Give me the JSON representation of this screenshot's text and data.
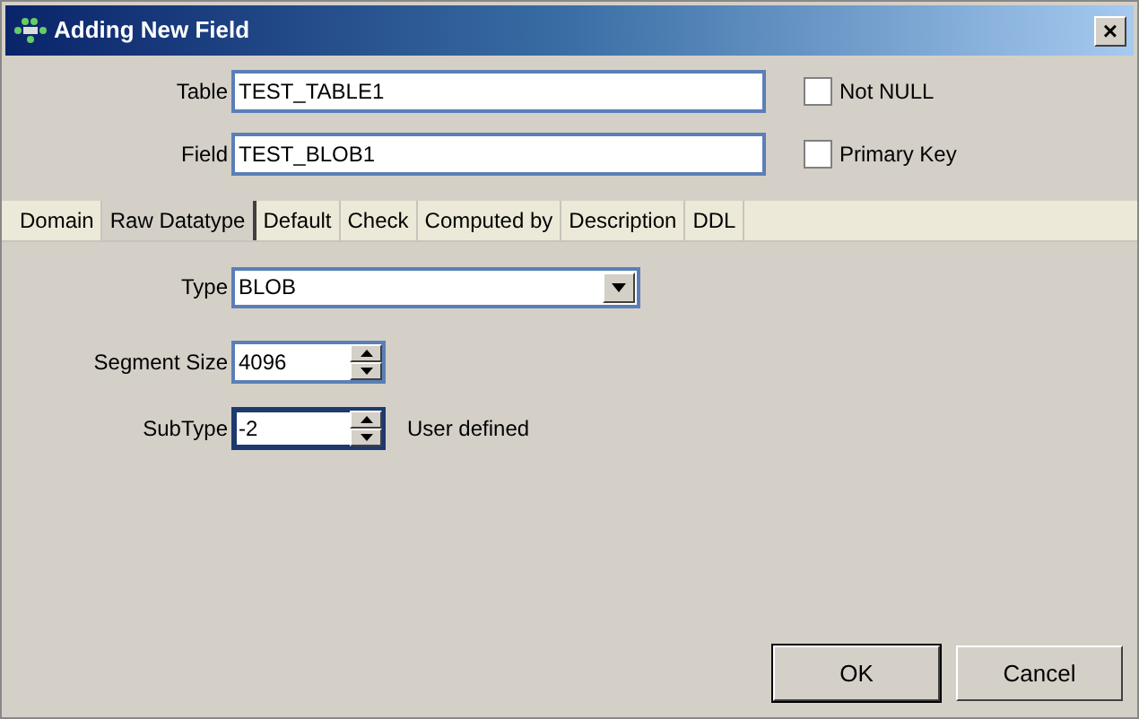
{
  "window": {
    "title": "Adding New Field",
    "close": "×"
  },
  "fields": [
    {
      "label": "Table",
      "value": "TEST_TABLE1",
      "focused": false,
      "check": {
        "label": "Not NULL",
        "checked": false
      }
    },
    {
      "label": "Field",
      "value": "TEST_BLOB1",
      "focused": false,
      "check": {
        "label": "Primary Key",
        "checked": false
      }
    }
  ],
  "tabs": [
    {
      "label": "Domain",
      "selected": false
    },
    {
      "label": "Raw Datatype",
      "selected": true
    },
    {
      "label": "Default",
      "selected": false
    },
    {
      "label": "Check",
      "selected": false
    },
    {
      "label": "Computed by",
      "selected": false
    },
    {
      "label": "Description",
      "selected": false
    },
    {
      "label": "DDL",
      "selected": false
    }
  ],
  "type": {
    "label": "Type",
    "value": "BLOB"
  },
  "spinners": [
    {
      "label": "Segment Size",
      "value": "4096",
      "focused": false
    },
    {
      "label": "SubType",
      "value": "-2",
      "focused": true,
      "note": "User defined"
    }
  ],
  "buttons": [
    {
      "label": "OK",
      "default": true
    },
    {
      "label": "Cancel",
      "default": false
    }
  ]
}
